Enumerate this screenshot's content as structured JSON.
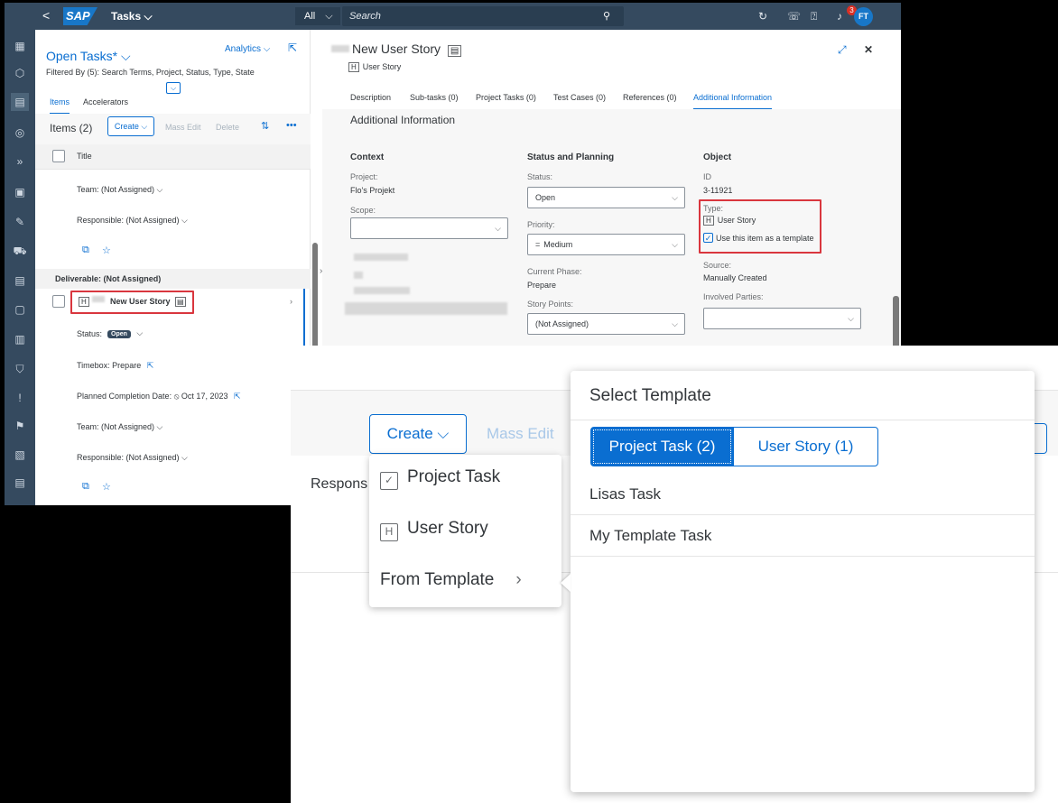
{
  "shellbar": {
    "back": "<",
    "logo": "SAP",
    "app_title": "Tasks ⌵",
    "scope": "All",
    "search_placeholder": "Search",
    "notification_count": "3",
    "avatar_initials": "FT"
  },
  "list": {
    "title": "Open Tasks* ⌵",
    "analytics": "Analytics ⌵",
    "filter": "Filtered By (5): Search Terms, Project, Status, Type, State",
    "tabs": [
      "Items",
      "Accelerators"
    ],
    "items_count": "Items (2)",
    "create": "Create ⌵",
    "mass_edit": "Mass Edit",
    "delete": "Delete",
    "column_title": "Title",
    "team1": "Team: (Not Assigned) ⌵",
    "responsible1": "Responsible: (Not Assigned) ⌵",
    "group": "Deliverable: (Not Assigned)",
    "item_title": "New User Story",
    "status_label": "Status:",
    "status_value": "Open",
    "timebox": "Timebox: Prepare",
    "planned": "Planned Completion Date: ⦸ Oct 17, 2023",
    "team2": "Team: (Not Assigned) ⌵",
    "responsible2": "Responsible: (Not Assigned) ⌵"
  },
  "detail": {
    "title": "New User Story",
    "subtype": "User Story",
    "tabs": [
      "Description",
      "Sub-tasks (0)",
      "Project Tasks (0)",
      "Test Cases (0)",
      "References (0)",
      "Additional Information"
    ],
    "section_title": "Additional Information",
    "context": {
      "heading": "Context",
      "project_label": "Project:",
      "project_value": "Flo's Projekt",
      "scope_label": "Scope:"
    },
    "status_planning": {
      "heading": "Status and Planning",
      "status_label": "Status:",
      "status_value": "Open",
      "priority_label": "Priority:",
      "priority_value": "Medium",
      "phase_label": "Current Phase:",
      "phase_value": "Prepare",
      "points_label": "Story Points:",
      "points_value": "(Not Assigned)"
    },
    "object": {
      "heading": "Object",
      "id_label": "ID",
      "id_value": "3-11921",
      "type_label": "Type:",
      "type_value": "User Story",
      "template_checkbox": "Use this item as a template",
      "source_label": "Source:",
      "source_value": "Manually Created",
      "parties_label": "Involved Parties:"
    }
  },
  "zoom": {
    "create": "Create ⌵",
    "mass_edit": "Mass Edit",
    "respons": "Respons",
    "menu": [
      "Project Task",
      "User Story",
      "From Template"
    ],
    "popover_title": "Select Template",
    "segments": [
      "Project Task (2)",
      "User Story (1)"
    ],
    "templates": [
      "Lisas Task",
      "My Template Task"
    ]
  }
}
